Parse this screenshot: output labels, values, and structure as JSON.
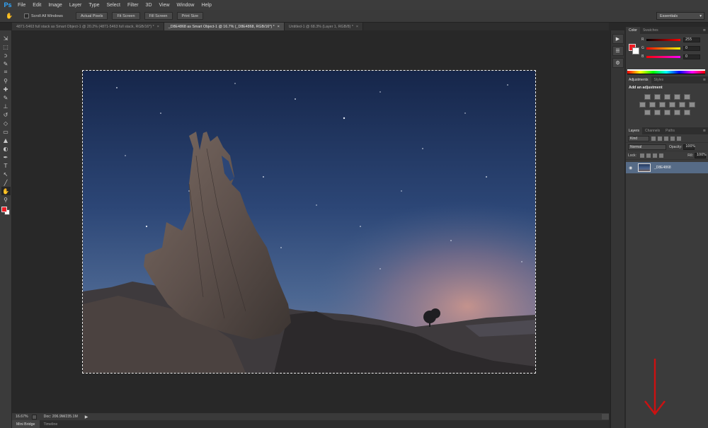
{
  "app": {
    "logo": "Ps"
  },
  "menu": [
    "File",
    "Edit",
    "Image",
    "Layer",
    "Type",
    "Select",
    "Filter",
    "3D",
    "View",
    "Window",
    "Help"
  ],
  "options": {
    "scroll_all_windows": "Scroll All Windows",
    "buttons": [
      "Actual Pixels",
      "Fit Screen",
      "Fill Screen",
      "Print Size"
    ],
    "workspace": "Essentials"
  },
  "tabs": [
    {
      "label": "4871-5463 full stack as Smart Object-1 @ 20.2% (4871-5463 full stack, RGB/16*) *",
      "active": false
    },
    {
      "label": "_D8E4868 as Smart Object-1 @ 16.7% (_D8E4868, RGB/16*) *",
      "active": true
    },
    {
      "label": "Untitled-1 @ 68.3% (Layer 1, RGB/8) *",
      "active": false
    }
  ],
  "status": {
    "zoom": "16.67%",
    "doc_info": "Doc: 206.9M/235.1M",
    "arrow": "▶"
  },
  "bottom_tabs": [
    "Mini Bridge",
    "Timeline"
  ],
  "panels": {
    "color_tabs": [
      "Color",
      "Swatches"
    ],
    "color": {
      "r_label": "R",
      "g_label": "G",
      "b_label": "B",
      "r": "255",
      "g": "0",
      "b": "0",
      "fg": "#ed1c24",
      "bg": "#ffffff"
    },
    "adj_tabs": [
      "Adjustments",
      "Styles"
    ],
    "adj_title": "Add an adjustment",
    "layer_tabs": [
      "Layers",
      "Channels",
      "Paths"
    ],
    "kind": "Kind",
    "blend_mode": "Normal",
    "opacity_label": "Opacity:",
    "opacity": "100%",
    "lock_label": "Lock:",
    "fill_label": "Fill:",
    "fill": "100%",
    "layer_name": "_D8E4868"
  },
  "colors": {
    "annotation": "#cc1111",
    "selected_layer": "#566b86"
  },
  "icons": {
    "toolbar": [
      "move-icon",
      "marquee-icon",
      "lasso-icon",
      "quick-select-icon",
      "crop-icon",
      "eyedropper-icon",
      "healing-icon",
      "brush-icon",
      "stamp-icon",
      "history-brush-icon",
      "eraser-icon",
      "gradient-icon",
      "blur-icon",
      "dodge-icon",
      "pen-icon",
      "type-icon",
      "path-select-icon",
      "shape-icon",
      "hand-icon",
      "zoom-icon"
    ],
    "toolbar_glyphs": [
      "⇲",
      "⬚",
      "ↄ",
      "✎",
      "⌗",
      "⚲",
      "✚",
      "✎",
      "⊥",
      "↺",
      "◇",
      "▭",
      "▲",
      "◐",
      "✒",
      "T",
      "↖",
      "╱",
      "✋",
      "⚲"
    ]
  }
}
